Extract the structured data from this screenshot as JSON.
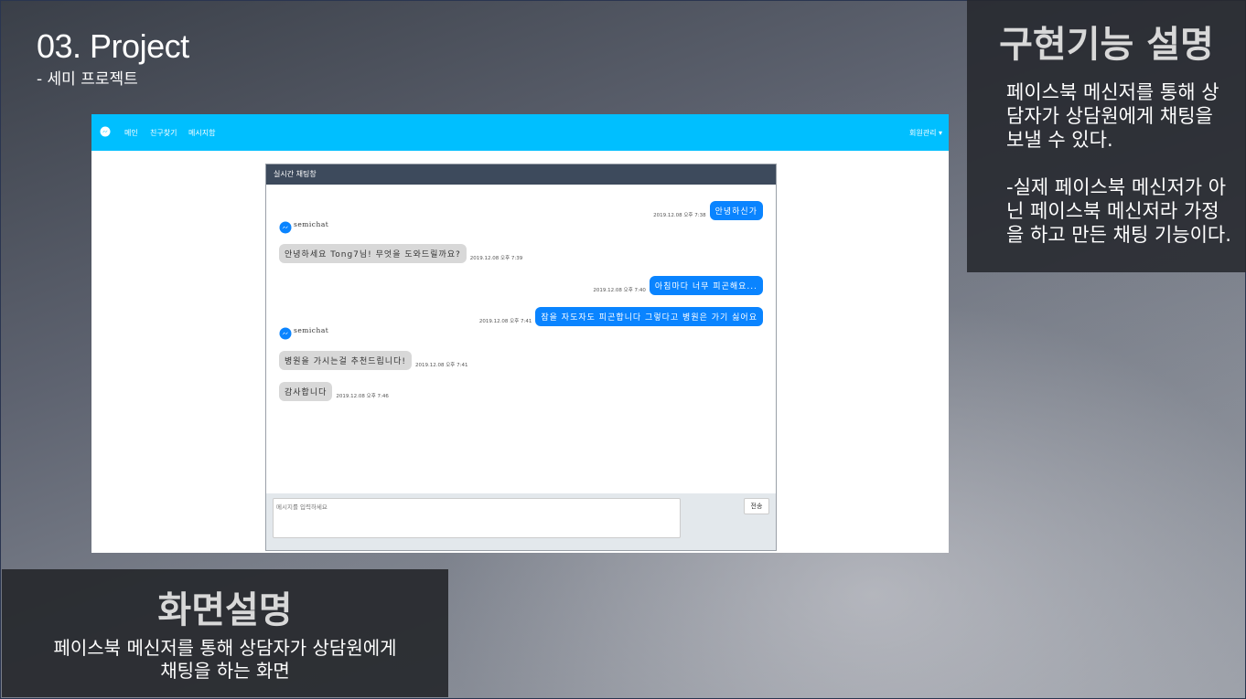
{
  "slide": {
    "title": "03. Project",
    "subtitle": "- 세미 프로젝트"
  },
  "feature_box": {
    "title": "구현기능 설명",
    "text": "페이스북 메신저를 통해 상담자가 상담원에게 채팅을 보낼 수 있다.\n\n-실제 페이스북 메신저가 아닌 페이스북 메신저라 가정을 하고 만든 채팅 기능이다."
  },
  "caption_box": {
    "title": "화면설명",
    "text": "페이스북 메신저를 통해 상담자가 상담원에게\n채팅을 하는 화면"
  },
  "app": {
    "navbar": {
      "brand_icon": "messenger-icon",
      "links": [
        "메인",
        "친구찾기",
        "메시지함"
      ],
      "right_menu": "회원관리 ▾"
    },
    "chat": {
      "header": "실시간 채팅창",
      "sender_name": "semichat",
      "messages": [
        {
          "side": "right",
          "text": "안녕하신가",
          "time": "2019.12.08 오후 7:38"
        },
        {
          "side": "left",
          "text": "안녕하세요 Tong7님! 무엇을 도와드릴까요?",
          "time": "2019.12.08 오후 7:39"
        },
        {
          "side": "right",
          "text": "아침마다 너무 피곤해요...",
          "time": "2019.12.08 오후 7:40"
        },
        {
          "side": "right",
          "text": "잠을 자도자도 피곤합니다 그렇다고 병원은 가기 싫어요",
          "time": "2019.12.08 오후 7:41"
        },
        {
          "side": "left",
          "text": "병원을 가시는걸 추천드립니다!",
          "time": "2019.12.08 오후 7:41"
        },
        {
          "side": "left",
          "text": "감사합니다",
          "time": "2019.12.08 오후 7:46"
        }
      ],
      "input_placeholder": "메시지를 입력하세요",
      "send_label": "전송"
    }
  },
  "colors": {
    "navbar": "#00bfff",
    "my_bubble": "#0a84ff",
    "their_bubble": "#d8d8d8",
    "chat_header": "#3d4a5c"
  }
}
